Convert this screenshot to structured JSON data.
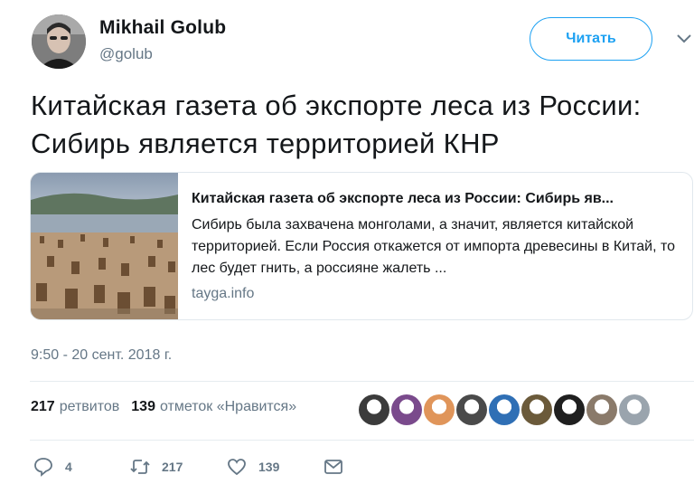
{
  "author": {
    "name": "Mikhail Golub",
    "handle": "@golub",
    "follow_label": "Читать"
  },
  "tweet": {
    "text": "Китайская газета об экспорте леса из России: Сибирь является территорией КНР"
  },
  "card": {
    "title": "Китайская газета об экспорте леса из России: Сибирь яв...",
    "description": "Сибирь была захвачена монголами, а значит, является китайской территорией. Если Россия откажется от импорта древесины в Китай, то лес будет гнить, а россияне жалеть ...",
    "domain": "tayga.info"
  },
  "timestamp": "9:50 - 20 сент. 2018 г.",
  "stats": {
    "retweets_count": "217",
    "retweets_label": "ретвитов",
    "likes_count": "139",
    "likes_label": "отметок «Нравится»"
  },
  "likers": [
    {
      "color": "#3b3b3b"
    },
    {
      "color": "#7a4a8c"
    },
    {
      "color": "#e0955a"
    },
    {
      "color": "#4a4a4a"
    },
    {
      "color": "#2f6fb5"
    },
    {
      "color": "#6b5a3a"
    },
    {
      "color": "#1f1f1f"
    },
    {
      "color": "#8a7a6a"
    },
    {
      "color": "#9aa4ad"
    }
  ],
  "actions": {
    "reply_count": "4",
    "retweet_count": "217",
    "like_count": "139"
  },
  "icons": {
    "reply": "reply-icon",
    "retweet": "retweet-icon",
    "like": "heart-icon",
    "dm": "envelope-icon",
    "caret": "chevron-down-icon"
  },
  "colors": {
    "accent": "#1da1f2",
    "muted": "#657786",
    "text": "#14171a"
  }
}
